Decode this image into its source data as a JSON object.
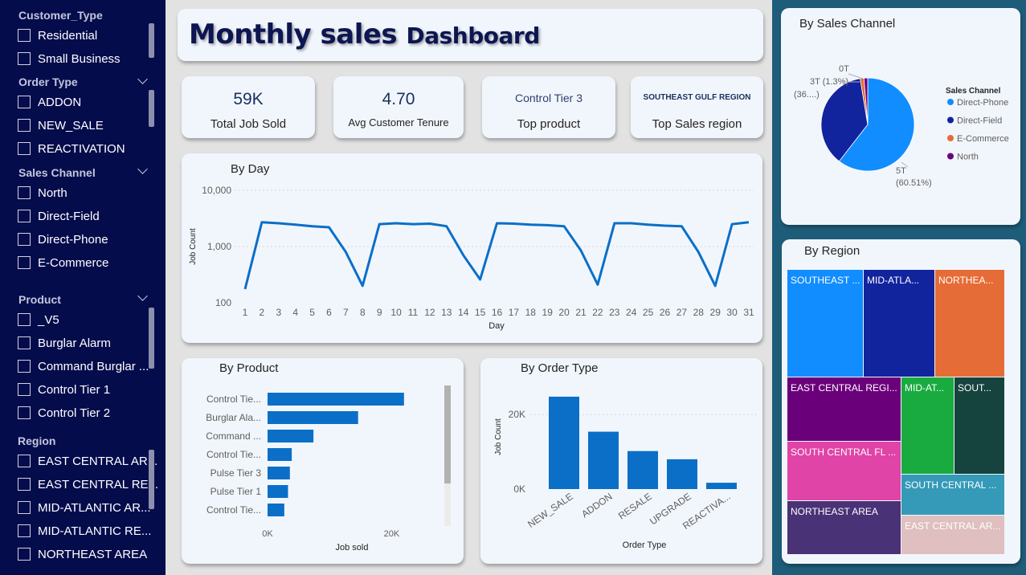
{
  "sidebar": {
    "customer_type": {
      "title": "Customer_Type",
      "options": [
        "Residential",
        "Small Business"
      ]
    },
    "order_type": {
      "title": "Order Type",
      "options": [
        "ADDON",
        "NEW_SALE",
        "REACTIVATION"
      ]
    },
    "sales_channel": {
      "title": "Sales Channel",
      "options": [
        "North",
        "Direct-Field",
        "Direct-Phone",
        "E-Commerce"
      ]
    },
    "product": {
      "title": "Product",
      "options": [
        "_V5",
        "Burglar Alarm",
        "Command Burglar ...",
        "Control Tier 1",
        "Control Tier 2"
      ]
    },
    "region": {
      "title": "Region",
      "options": [
        "EAST CENTRAL AR...",
        "EAST CENTRAL RE...",
        "MID-ATLANTIC AR...",
        "MID-ATLANTIC RE...",
        "NORTHEAST AREA"
      ]
    }
  },
  "header": {
    "title_main": "Monthly sales",
    "title_sub": "Dashboard"
  },
  "kpis": [
    {
      "value": "59K",
      "label": "Total Job Sold"
    },
    {
      "value": "4.70",
      "label": "Avg Customer Tenure"
    },
    {
      "value": "Control Tier 3",
      "label": "Top product"
    },
    {
      "value": "SOUTHEAST GULF REGION",
      "label": "Top Sales region"
    }
  ],
  "colors": {
    "sidebar_bg": "#050c4c",
    "right_bg": "#1e5d7a",
    "bar_blue": "#0b6fc7",
    "title_navy": "#0d1650"
  },
  "by_day": {
    "title": "By Day",
    "chart_data": {
      "type": "line",
      "xlabel": "Day",
      "ylabel": "Job Count",
      "yscale": "log",
      "ylim": [
        100,
        10000
      ],
      "ytick_labels": [
        "10,000",
        "1,000",
        "100"
      ],
      "x": [
        1,
        2,
        3,
        4,
        5,
        6,
        7,
        8,
        9,
        10,
        11,
        12,
        13,
        14,
        15,
        16,
        17,
        18,
        19,
        20,
        21,
        22,
        23,
        24,
        25,
        26,
        27,
        28,
        29,
        30,
        31
      ],
      "values": [
        175,
        2700,
        2600,
        2450,
        2300,
        2200,
        800,
        200,
        2500,
        2600,
        2500,
        2550,
        2300,
        700,
        260,
        2600,
        2550,
        2450,
        2400,
        2300,
        850,
        210,
        2600,
        2600,
        2450,
        2350,
        2300,
        800,
        200,
        2500,
        2700
      ]
    }
  },
  "by_product": {
    "title": "By Product",
    "chart_data": {
      "type": "bar",
      "orientation": "horizontal",
      "xlabel": "Job sold",
      "xtick_labels": [
        "0K",
        "20K"
      ],
      "xlim": [
        0,
        25000
      ],
      "categories": [
        "Control Tie...",
        "Burglar Ala...",
        "Command ...",
        "Control Tie...",
        "Pulse Tier 3",
        "Pulse Tier 1",
        "Control Tie..."
      ],
      "values": [
        22000,
        14600,
        7400,
        3900,
        3600,
        3300,
        2700
      ]
    }
  },
  "by_order_type": {
    "title": "By Order Type",
    "chart_data": {
      "type": "bar",
      "xlabel": "Order Type",
      "ylabel": "Job Count",
      "ytick_labels": [
        "20K",
        "0K"
      ],
      "ylim": [
        0,
        25000
      ],
      "categories": [
        "NEW_SALE",
        "ADDON",
        "RESALE",
        "UPGRADE",
        "REACTIVA..."
      ],
      "values": [
        24800,
        15400,
        10200,
        8000,
        1700
      ]
    }
  },
  "by_sales_channel": {
    "title": "By Sales Channel",
    "legend_title": "Sales Channel",
    "chart_data": {
      "type": "pie",
      "legend_position": "right",
      "slices": [
        {
          "name": "Direct-Phone",
          "label": "5T",
          "percent_label": "(60.51%)",
          "value": 60.51,
          "color": "#118dff"
        },
        {
          "name": "Direct-Field",
          "label": "3T",
          "percent_label": "(36....)",
          "value": 36.89,
          "color": "#12239e"
        },
        {
          "name": "E-Commerce",
          "label": "3T",
          "percent_label": "(1.3%)",
          "value": 1.3,
          "color": "#e66c37"
        },
        {
          "name": "North",
          "label": "0T",
          "percent_label": "",
          "value": 1.3,
          "color": "#6b007b"
        }
      ]
    }
  },
  "by_region": {
    "title": "By Region",
    "cells": [
      "SOUTHEAST ...",
      "MID-ATLA...",
      "NORTHEA...",
      "EAST CENTRAL REGI...",
      "MID-AT...",
      "SOUT...",
      "SOUTH CENTRAL FL ...",
      "SOUTH CENTRAL ...",
      "NORTHEAST AREA",
      "EAST CENTRAL AR..."
    ]
  }
}
